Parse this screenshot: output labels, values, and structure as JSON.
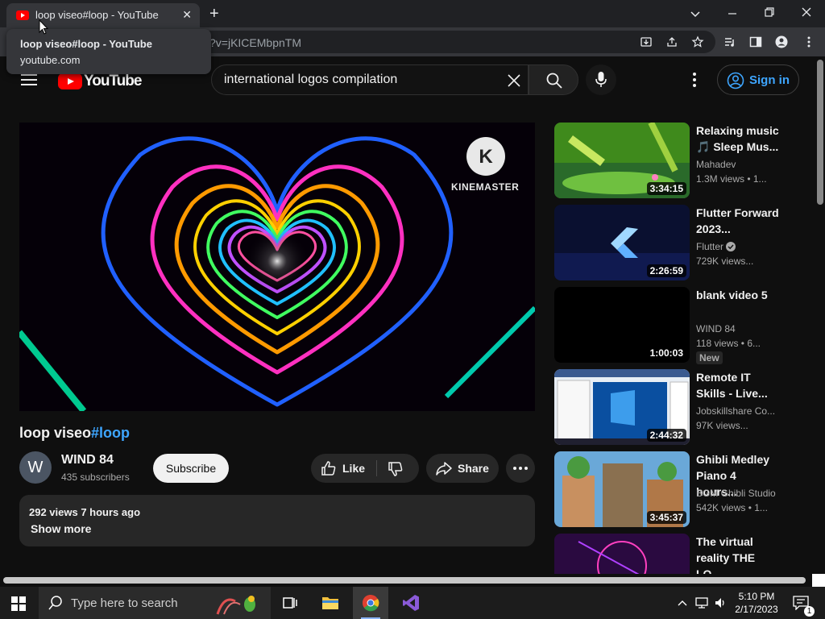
{
  "browser": {
    "tab_title": "loop viseo#loop - YouTube",
    "tab_close": "✕",
    "new_tab": "+",
    "url": "?v=jKICEMbpnTM",
    "tooltip": {
      "title": "loop viseo#loop - YouTube",
      "domain": "youtube.com"
    }
  },
  "header": {
    "logo": "YouTube",
    "search_value": "international logos compilation",
    "sign_in": "Sign in"
  },
  "player": {
    "watermark": "KINEMASTER",
    "watermark_mark": "K"
  },
  "video": {
    "title_main": "loop viseo",
    "title_tag": "#loop",
    "channel": "WIND 84",
    "channel_initial": "W",
    "subscribers": "435 subscribers",
    "subscribe": "Subscribe",
    "like": "Like",
    "share": "Share",
    "stats": "292 views  7 hours ago",
    "show_more": "Show more"
  },
  "recommendations": [
    {
      "title": "Relaxing music 🎵 Sleep Mus...",
      "channel": "Mahadev",
      "meta": "1.3M views  • 1...",
      "duration": "3:34:15",
      "verified": false,
      "badge": ""
    },
    {
      "title": "Flutter Forward 2023...",
      "channel": "Flutter",
      "meta": "729K views...",
      "duration": "2:26:59",
      "verified": true,
      "badge": ""
    },
    {
      "title": "blank video 5",
      "channel": "WIND 84",
      "meta": "118 views  • 6...",
      "duration": "1:00:03",
      "verified": false,
      "badge": "New"
    },
    {
      "title": "Remote IT Skills - Live...",
      "channel": "Jobskillshare Co...",
      "meta": "97K views...",
      "duration": "2:44:32",
      "verified": false,
      "badge": ""
    },
    {
      "title": "Ghibli Medley Piano 4 hours...",
      "channel": "BGM Ghibli Studio",
      "meta": "542K views  • 1...",
      "duration": "3:45:37",
      "verified": false,
      "badge": ""
    },
    {
      "title": "The virtual reality THE LO...",
      "channel": "",
      "meta": "",
      "duration": "",
      "verified": false,
      "badge": ""
    }
  ],
  "taskbar": {
    "search_placeholder": "Type here to search",
    "time": "5:10 PM",
    "date": "2/17/2023",
    "notifications": "1"
  },
  "colors": {
    "accent_blue": "#3ea6ff",
    "yt_red": "#ff0000",
    "bg": "#0f0f0f"
  }
}
